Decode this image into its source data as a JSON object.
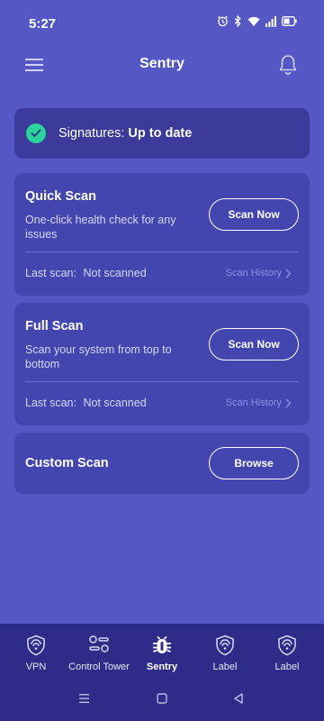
{
  "status_bar": {
    "time": "5:27",
    "icons": [
      "alarm-icon",
      "bluetooth-icon",
      "wifi-icon",
      "signal-icon",
      "battery-icon"
    ]
  },
  "app_bar": {
    "title": "Sentry",
    "menu_icon": "hamburger-menu-icon",
    "notification_icon": "bell-icon"
  },
  "signatures": {
    "label": "Signatures:",
    "status": "Up to date",
    "icon": "check-circle-icon"
  },
  "quick_scan": {
    "title": "Quick Scan",
    "description": "One-click health check for any issues",
    "button_label": "Scan Now",
    "last_scan_label": "Last scan:",
    "last_scan_value": "Not scanned",
    "history_label": "Scan History"
  },
  "full_scan": {
    "title": "Full Scan",
    "description": "Scan your system from top to bottom",
    "button_label": "Scan Now",
    "last_scan_label": "Last scan:",
    "last_scan_value": "Not scanned",
    "history_label": "Scan History"
  },
  "custom_scan": {
    "title": "Custom Scan",
    "button_label": "Browse"
  },
  "bottom_nav": {
    "items": [
      {
        "label": "VPN",
        "icon": "vpn-shield-icon",
        "active": false
      },
      {
        "label": "Control Tower",
        "icon": "control-toggles-icon",
        "active": false
      },
      {
        "label": "Sentry",
        "icon": "bug-icon",
        "active": true
      },
      {
        "label": "Label",
        "icon": "shield-icon",
        "active": false
      },
      {
        "label": "Label",
        "icon": "shield-icon",
        "active": false
      }
    ]
  },
  "system_nav": {
    "icons": [
      "recents-icon",
      "home-icon",
      "back-icon"
    ]
  },
  "colors": {
    "background": "#5457c4",
    "card": "#4346af",
    "banner": "#3b3a9a",
    "nav": "#2e2c88",
    "success": "#2bd49a"
  }
}
